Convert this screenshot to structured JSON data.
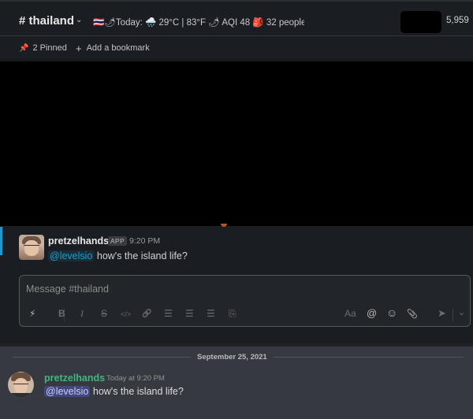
{
  "slack": {
    "channel_name": "# thailand",
    "topic": "🇹🇭🌶Today: 🌧️ 29°C | 83°F 🌶 AQI 48 🎒 32 people ...",
    "member_count": "5,959",
    "pinned_label": "2 Pinned",
    "add_bookmark_label": "Add a bookmark",
    "message": {
      "author": "pretzelhands",
      "badge": "APP",
      "time": "9:20 PM",
      "mention": "@levelsio",
      "text": "how's the island life?"
    },
    "composer_placeholder": "Message #thailand",
    "format_toolbar": {
      "shortcuts": "⚡",
      "bold": "B",
      "italic": "I",
      "strike": "S",
      "code": "</>",
      "link": "🔗",
      "ordered_list": "☰",
      "bulleted_list": "☰",
      "blockquote": "☰",
      "code_block": "⎘",
      "text_format": "Aa",
      "mention": "@",
      "emoji": "☺",
      "attach": "📎",
      "send": "➤",
      "send_options": "⌄"
    },
    "accent": "#1d9bd1"
  },
  "discord": {
    "date": "September 25, 2021",
    "message": {
      "author": "pretzelhands",
      "time": "Today at 9:20 PM",
      "mention": "@levelsio",
      "text": "how's the island life?"
    },
    "author_color": "#43b581"
  }
}
